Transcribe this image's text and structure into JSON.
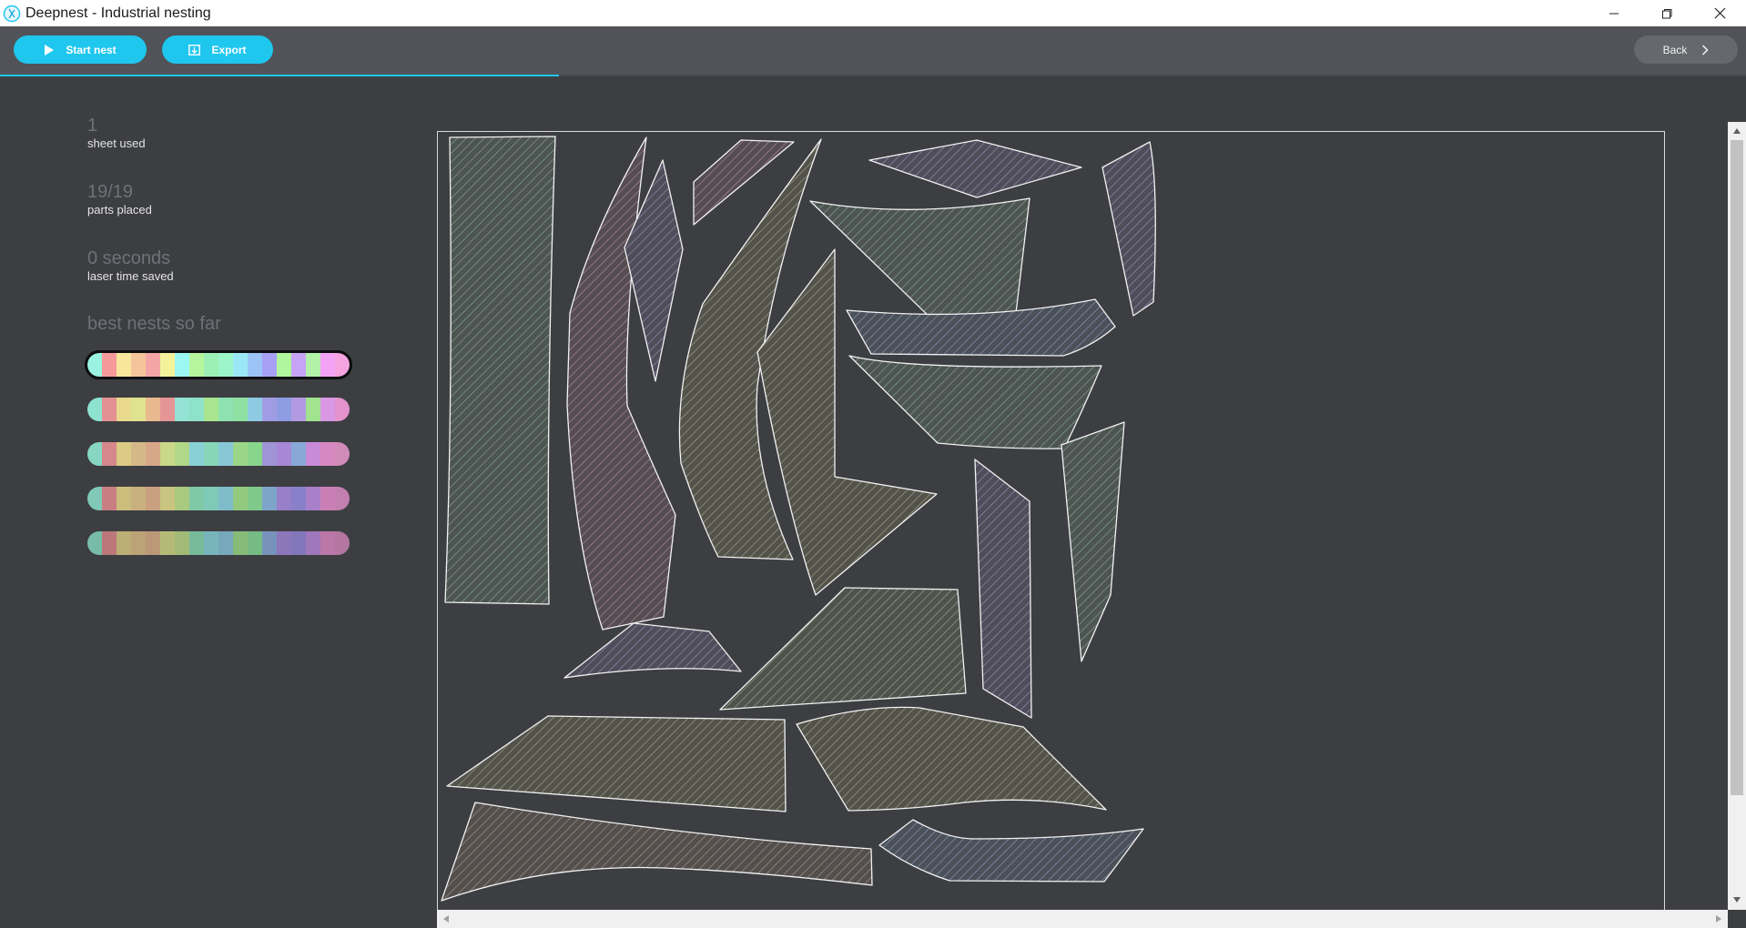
{
  "window": {
    "title": "Deepnest - Industrial nesting",
    "app_icon": "deepnest-logo-icon",
    "controls": [
      "minimize-icon",
      "restore-icon",
      "close-icon"
    ]
  },
  "toolbar": {
    "start_label": "Start nest",
    "export_label": "Export",
    "back_label": "Back",
    "progress": 0.32,
    "accent_color": "#1fc7ef"
  },
  "stats": {
    "sheets_value": "1",
    "sheets_label": "sheet used",
    "parts_value": "19/19",
    "parts_label": "parts placed",
    "time_value": "0 seconds",
    "time_label": "laser time saved",
    "best_title": "best nests so far"
  },
  "nests": [
    {
      "active": true,
      "colors": [
        "#9af2e1",
        "#f59a9a",
        "#f7e69c",
        "#f6c49a",
        "#f4a6a6",
        "#f4f39c",
        "#9cf6f2",
        "#b5f59c",
        "#9cf0b6",
        "#9cf5c9",
        "#9ce7f5",
        "#9cc3f5",
        "#a6a1f5",
        "#b1f59c",
        "#c7a2f5",
        "#b3f1a8",
        "#f3a2f5",
        "#f5a4e1"
      ]
    },
    {
      "active": false,
      "colors": [
        "#8de3cf",
        "#e39192",
        "#e8d98e",
        "#dfe28e",
        "#e8b98e",
        "#e59595",
        "#94e3d4",
        "#8ee2c7",
        "#a9e58e",
        "#8ee2b1",
        "#8ee1a1",
        "#8ecbe3",
        "#a09ce3",
        "#8e9ce3",
        "#b29ae3",
        "#a1e38e",
        "#d898e3",
        "#e392cd"
      ]
    },
    {
      "active": false,
      "colors": [
        "#86d6c3",
        "#d68789",
        "#dccb85",
        "#d5b888",
        "#d6a888",
        "#c9d788",
        "#b1d788",
        "#88d0d6",
        "#88d6b8",
        "#88c8d6",
        "#9bd688",
        "#88d68c",
        "#9f94d6",
        "#a888d6",
        "#88a9d6",
        "#c98bd6",
        "#d688c2",
        "#d18bb9"
      ]
    },
    {
      "active": false,
      "colors": [
        "#7fc9b6",
        "#c97f82",
        "#cdbd7c",
        "#c9b07f",
        "#c9a07f",
        "#c9c47f",
        "#a9c97f",
        "#7fc9a6",
        "#7fc9b9",
        "#7fbcc9",
        "#92c97f",
        "#7fc98a",
        "#7fa4c9",
        "#977fc9",
        "#8a7fc9",
        "#a97fc9",
        "#c97fb4",
        "#c27fb0"
      ]
    },
    {
      "active": false,
      "colors": [
        "#77bba9",
        "#bb7779",
        "#bcae74",
        "#bba277",
        "#bb9877",
        "#b5bb77",
        "#a1bb77",
        "#77bb9a",
        "#77b5bb",
        "#77a8bb",
        "#87bb77",
        "#77bb84",
        "#7793bb",
        "#8d77bb",
        "#8277bb",
        "#9f77bb",
        "#bb77a7",
        "#b377a1"
      ]
    }
  ]
}
